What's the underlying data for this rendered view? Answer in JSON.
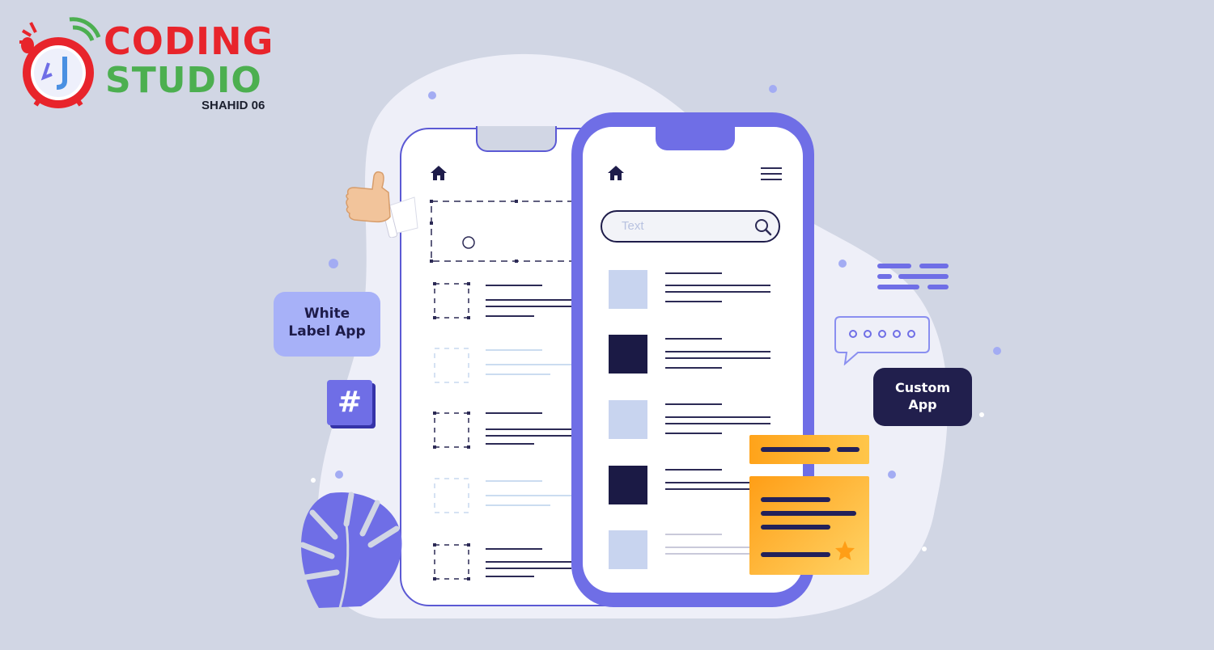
{
  "logo": {
    "line1": "CODING",
    "line2": "STUDIO",
    "line3": "SHAHID 06",
    "icon": "alarm-clock-logo-icon"
  },
  "left_phone": {
    "home_icon": "home-icon",
    "cursor_icon": "thumbs-up-hand-icon"
  },
  "right_phone": {
    "home_icon": "home-icon",
    "menu_icon": "hamburger-menu-icon",
    "search": {
      "placeholder": "Text",
      "icon": "search-icon"
    }
  },
  "badges": {
    "white_label": [
      "White",
      "Label App"
    ],
    "custom": [
      "Custom",
      "App"
    ],
    "hash": "#"
  },
  "colors": {
    "background": "#d1d6e4",
    "accent": "#6f6ee6",
    "dark": "#211f4d",
    "coding_red": "#e8242b",
    "studio_green": "#4caf50",
    "orange": "#ffa31a"
  }
}
